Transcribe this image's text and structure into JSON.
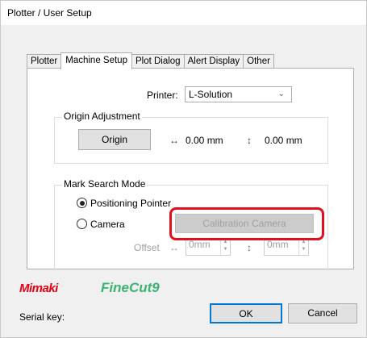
{
  "window": {
    "title": "Plotter / User Setup"
  },
  "tabs": [
    {
      "label": "Plotter",
      "active": false
    },
    {
      "label": "Machine Setup",
      "active": true
    },
    {
      "label": "Plot Dialog",
      "active": false
    },
    {
      "label": "Alert Display",
      "active": false
    },
    {
      "label": "Other",
      "active": false
    }
  ],
  "printer": {
    "label": "Printer:",
    "value": "L-Solution",
    "chevron": "⌄"
  },
  "origin": {
    "group_label": "Origin Adjustment",
    "button_label": "Origin",
    "x_symbol": "↔",
    "x_value": "0.00 mm",
    "y_symbol": "↕",
    "y_value": "0.00 mm"
  },
  "mark_search": {
    "group_label": "Mark Search Mode",
    "positioning_pointer_label": "Positioning Pointer",
    "positioning_pointer_selected": true,
    "camera_label": "Camera",
    "camera_selected": false,
    "calibration_button_label": "Calibration Camera",
    "offset_label": "Offset",
    "offset_x_symbol": "↔",
    "offset_x_value": "0mm",
    "offset_y_symbol": "↕",
    "offset_y_value": "0mm"
  },
  "branding": {
    "mimaki": "Mimaki",
    "finecut": "FineCut9"
  },
  "footer": {
    "serial_label": "Serial key:",
    "ok_label": "OK",
    "cancel_label": "Cancel"
  },
  "colors": {
    "highlight": "#e2101d",
    "mimaki_red": "#e60012",
    "finecut_green": "#3cb371"
  }
}
